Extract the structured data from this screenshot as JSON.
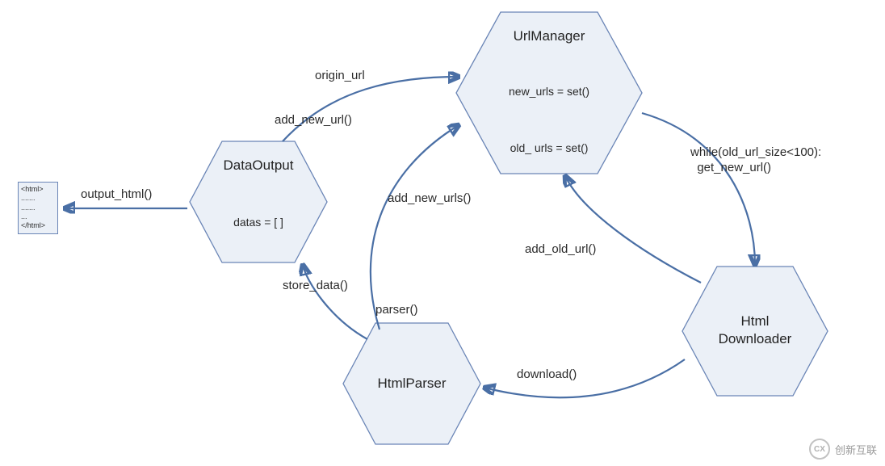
{
  "nodes": {
    "url_manager": {
      "title": "UrlManager",
      "line1": "new_urls = set()",
      "line2": "old_ urls = set()"
    },
    "data_output": {
      "title": "DataOutput",
      "line1": "datas = [ ]"
    },
    "html_parser": {
      "title": "HtmlParser"
    },
    "html_downloader": {
      "title_l1": "Html",
      "title_l2": "Downloader"
    },
    "html_file": {
      "l1": "<html>",
      "l2": ".......",
      "l3": ".......",
      "l4": "...",
      "l5": "</html>"
    }
  },
  "edges": {
    "output_html": "output_html()",
    "origin_url": "origin_url",
    "add_new_url": "add_new_url()",
    "add_new_urls": "add_new_urls()",
    "store_data": "store_data()",
    "parser": "parser()",
    "add_old_url": "add_old_url()",
    "download": "download()",
    "while_get": "while(old_url_size<100):\n  get_new_url()"
  },
  "watermark": "创新互联",
  "colors": {
    "hex_fill": "#ebf0f7",
    "hex_stroke": "#6a85b6",
    "arrow": "#4a6fa5"
  }
}
